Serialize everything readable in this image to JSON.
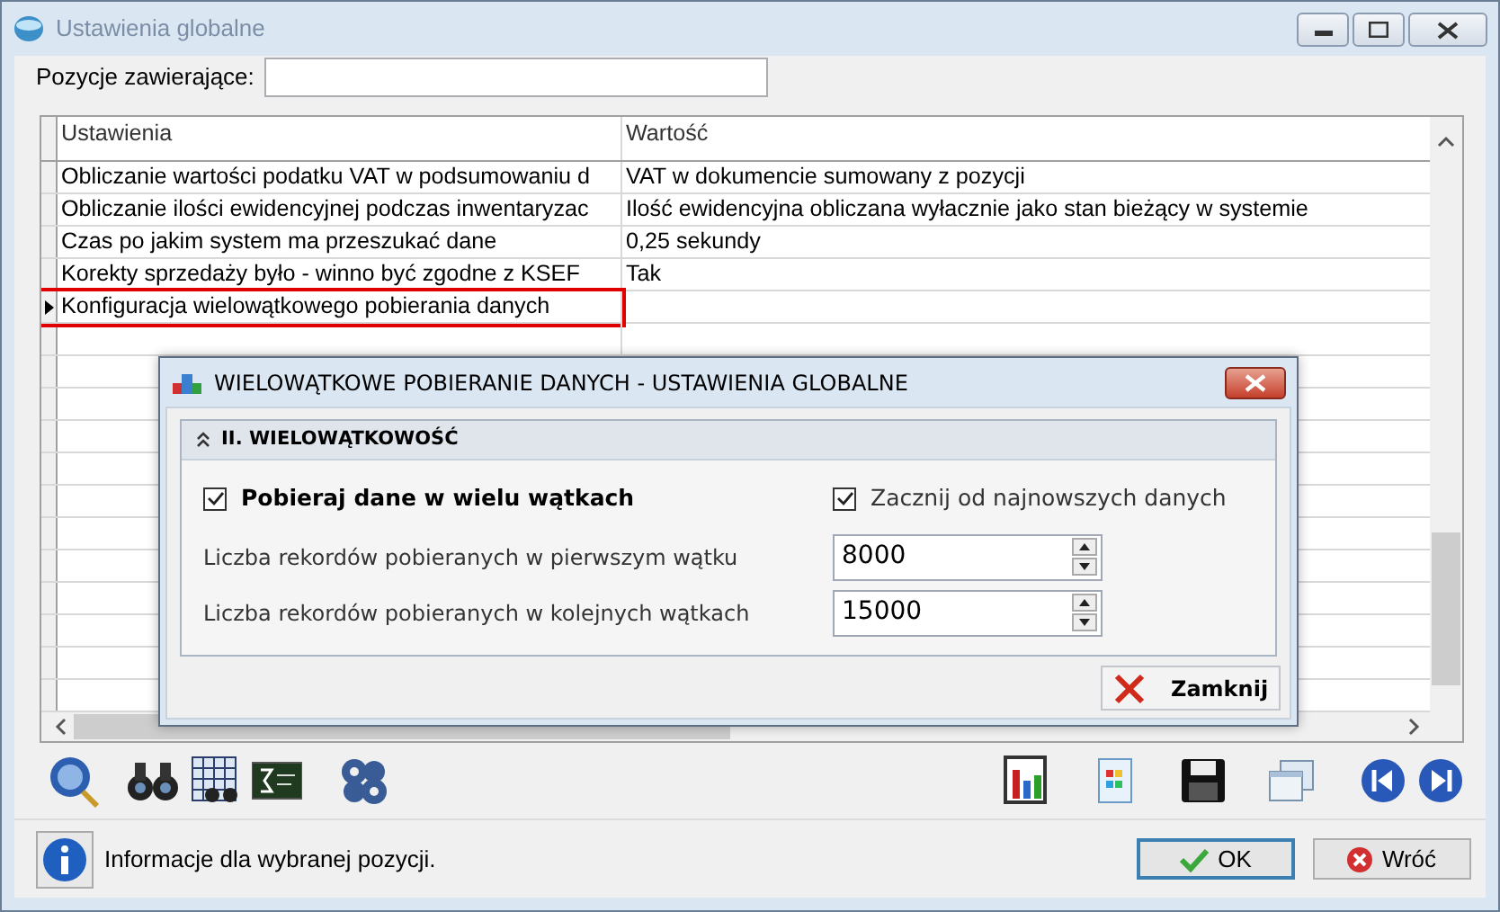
{
  "window": {
    "title": "Ustawienia globalne"
  },
  "filter": {
    "label": "Pozycje zawierające:"
  },
  "table": {
    "columns": [
      "Ustawienia",
      "Wartość"
    ],
    "rows": [
      {
        "cells": [
          "Obliczanie wartości podatku VAT w podsumowaniu d",
          "VAT w dokumencie sumowany z pozycji"
        ],
        "selected": false,
        "outlined": false
      },
      {
        "cells": [
          "Obliczanie ilości ewidencyjnej podczas inwentaryzac",
          "Ilość ewidencyjna obliczana wyłacznie jako stan bieżący w systemie"
        ],
        "selected": false,
        "outlined": false
      },
      {
        "cells": [
          "Czas po jakim system ma przeszukać dane",
          "0,25 sekundy"
        ],
        "selected": false,
        "outlined": false
      },
      {
        "cells": [
          "Korekty sprzedaży było - winno być zgodne z KSEF",
          "Tak"
        ],
        "selected": false,
        "outlined": false
      },
      {
        "cells": [
          "Konfiguracja wielowątkowego pobierania danych",
          ""
        ],
        "selected": true,
        "outlined": true
      }
    ]
  },
  "dialog": {
    "title": "WIELOWĄTKOWE POBIERANIE DANYCH - USTAWIENIA GLOBALNE",
    "section": {
      "title": "II. WIELOWĄTKOWOŚĆ",
      "expanded": true
    },
    "checkboxes": [
      {
        "label": "Pobieraj dane w wielu wątkach",
        "checked": true,
        "kind": "bold"
      },
      {
        "label": "Zacznij od najnowszych danych",
        "checked": true,
        "kind": "plain"
      }
    ],
    "spinners": [
      {
        "label": "Liczba rekordów pobieranych w pierwszym wątku",
        "value": "8000"
      },
      {
        "label": "Liczba rekordów pobieranych w kolejnych wątkach",
        "value": "15000"
      }
    ],
    "close_button": "Zamknij"
  },
  "footer": {
    "info": "Informacje dla wybranej pozycji.",
    "buttons": [
      {
        "label": "OK",
        "kind": "ok",
        "focused": true
      },
      {
        "label": "Wróć",
        "kind": "back",
        "focused": false
      }
    ]
  }
}
